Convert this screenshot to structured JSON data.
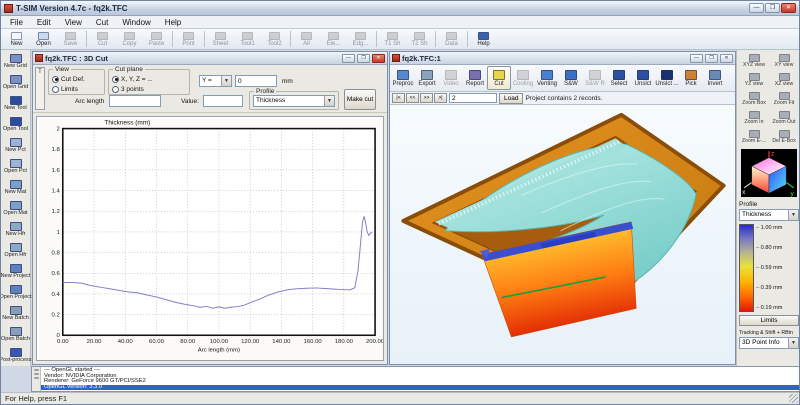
{
  "window": {
    "title": "T-SIM Version 4.7c - fq2k.TFC",
    "controls": {
      "minimize": "—",
      "maximize": "❐",
      "close": "✕"
    }
  },
  "menu": [
    "File",
    "Edit",
    "View",
    "Cut",
    "Window",
    "Help"
  ],
  "toolbar": {
    "groups": [
      {
        "items": [
          {
            "label": "New",
            "icon": "new-file",
            "enabled": true,
            "color": "#f2f7ff"
          },
          {
            "label": "Open",
            "icon": "open-folder",
            "enabled": true,
            "color": "#c9daf2"
          },
          {
            "label": "Save",
            "icon": "save",
            "enabled": false,
            "color": "#9aa2ac"
          }
        ]
      },
      {
        "items": [
          {
            "label": "Cut",
            "icon": "cut-scissors",
            "enabled": false,
            "color": "#9aa2ac"
          },
          {
            "label": "Copy",
            "icon": "copy",
            "enabled": false,
            "color": "#9aa2ac"
          },
          {
            "label": "Paste",
            "icon": "paste",
            "enabled": false,
            "color": "#9aa2ac"
          }
        ]
      },
      {
        "items": [
          {
            "label": "Print",
            "icon": "print",
            "enabled": false,
            "color": "#9aa2ac"
          }
        ]
      },
      {
        "items": [
          {
            "label": "Sheet",
            "icon": "sheet",
            "enabled": false,
            "color": "#9aa2ac"
          },
          {
            "label": "Tool1",
            "icon": "tool1",
            "enabled": false,
            "color": "#9aa2ac"
          },
          {
            "label": "Tool2",
            "icon": "tool2",
            "enabled": false,
            "color": "#9aa2ac"
          }
        ]
      },
      {
        "items": [
          {
            "label": "All",
            "icon": "show-all",
            "enabled": false,
            "color": "#9aa2ac"
          },
          {
            "label": "Ele...",
            "icon": "elements",
            "enabled": false,
            "color": "#9aa2ac"
          },
          {
            "label": "Edg...",
            "icon": "edges",
            "enabled": false,
            "color": "#9aa2ac"
          }
        ]
      },
      {
        "items": [
          {
            "label": "T1 Sh",
            "icon": "tool1-sheet",
            "enabled": false,
            "color": "#9aa2ac"
          },
          {
            "label": "T2 Sh",
            "icon": "tool2-sheet",
            "enabled": false,
            "color": "#9aa2ac"
          }
        ]
      },
      {
        "items": [
          {
            "label": "Data",
            "icon": "data",
            "enabled": false,
            "color": "#9aa2ac"
          }
        ]
      },
      {
        "items": [
          {
            "label": "Help",
            "icon": "help",
            "enabled": true,
            "color": "#3a5fae"
          }
        ]
      }
    ]
  },
  "left_rail": [
    {
      "label": "New Grid",
      "icon": "new-grid-icon",
      "color": "#7d8fc4"
    },
    {
      "label": "Open Grid",
      "icon": "open-grid-icon",
      "color": "#7d8fc4"
    },
    {
      "label": "New Tool",
      "icon": "new-tool-icon",
      "color": "#2d4a9e"
    },
    {
      "label": "Open Tool",
      "icon": "open-tool-icon",
      "color": "#2d4a9e"
    },
    {
      "label": "New Pct",
      "icon": "new-pct-icon",
      "color": "#9fb2d4"
    },
    {
      "label": "Open Pct",
      "icon": "open-pct-icon",
      "color": "#9fb2d4"
    },
    {
      "label": "New Mat",
      "icon": "new-mat-icon",
      "color": "#7ba0c8"
    },
    {
      "label": "Open Mat",
      "icon": "open-mat-icon",
      "color": "#7ba0c8"
    },
    {
      "label": "New Hfr",
      "icon": "new-hfr-icon",
      "color": "#8fa8c8"
    },
    {
      "label": "Open Hfr",
      "icon": "open-hfr-icon",
      "color": "#8fa8c8"
    },
    {
      "label": "New Project",
      "icon": "new-project-icon",
      "color": "#5f7fc0"
    },
    {
      "label": "Open Project",
      "icon": "open-project-icon",
      "color": "#5f7fc0"
    },
    {
      "label": "New Batch",
      "icon": "new-batch-icon",
      "color": "#8c9cb8"
    },
    {
      "label": "Open Batch",
      "icon": "open-batch-icon",
      "color": "#8c9cb8"
    },
    {
      "label": "Post-process",
      "icon": "post-process-icon",
      "color": "#3b55b0"
    }
  ],
  "cut_window": {
    "title": "fq2k.TFC : 3D Cut",
    "side_tab": "T",
    "view_group": {
      "label": "View",
      "options": [
        {
          "label": "Cut Def.",
          "selected": true
        },
        {
          "label": "Limits",
          "selected": false
        }
      ]
    },
    "cut_plane_group": {
      "label": "Cut plane",
      "options": [
        {
          "label": "X, Y, Z = ...",
          "selected": true
        },
        {
          "label": "3 points",
          "selected": false
        }
      ]
    },
    "axis_select": "Y =",
    "axis_value": "0",
    "axis_unit": "mm",
    "arc_length_label": "Arc length",
    "value_label": "Value:",
    "profile_group": {
      "label": "Profile",
      "selected": "Thickness"
    },
    "make_cut_label": "Make cut"
  },
  "chart_data": {
    "type": "line",
    "title": "Thickness (mm)",
    "xlabel": "Arc length (mm)",
    "ylabel": "",
    "xlim": [
      0,
      200
    ],
    "ylim": [
      0,
      2
    ],
    "grid": true,
    "x_ticks": [
      "0.00",
      "20.00",
      "40.00",
      "60.00",
      "80.00",
      "100.00",
      "120.00",
      "140.00",
      "160.00",
      "180.00",
      "200.00"
    ],
    "y_ticks": [
      "0",
      "0.2",
      "0.4",
      "0.6",
      "0.8",
      "1",
      "1.2",
      "1.4",
      "1.6",
      "1.8",
      "2"
    ],
    "series": [
      {
        "name": "Thickness",
        "color": "#8080c8",
        "points": [
          [
            0,
            0.51
          ],
          [
            6,
            0.51
          ],
          [
            12,
            0.505
          ],
          [
            18,
            0.48
          ],
          [
            24,
            0.465
          ],
          [
            30,
            0.45
          ],
          [
            36,
            0.435
          ],
          [
            42,
            0.42
          ],
          [
            48,
            0.41
          ],
          [
            54,
            0.39
          ],
          [
            60,
            0.37
          ],
          [
            66,
            0.345
          ],
          [
            72,
            0.32
          ],
          [
            78,
            0.3
          ],
          [
            84,
            0.285
          ],
          [
            88,
            0.27
          ],
          [
            92,
            0.28
          ],
          [
            96,
            0.262
          ],
          [
            100,
            0.275
          ],
          [
            104,
            0.262
          ],
          [
            108,
            0.272
          ],
          [
            112,
            0.278
          ],
          [
            116,
            0.29
          ],
          [
            120,
            0.315
          ],
          [
            126,
            0.35
          ],
          [
            132,
            0.39
          ],
          [
            138,
            0.42
          ],
          [
            144,
            0.44
          ],
          [
            150,
            0.45
          ],
          [
            156,
            0.455
          ],
          [
            162,
            0.458
          ],
          [
            168,
            0.452
          ],
          [
            174,
            0.447
          ],
          [
            180,
            0.441
          ],
          [
            184,
            0.44
          ],
          [
            187,
            0.46
          ],
          [
            189,
            0.62
          ],
          [
            190.5,
            0.85
          ],
          [
            192,
            1.1
          ],
          [
            193,
            1.15
          ],
          [
            194,
            1.08
          ],
          [
            195,
            1.0
          ],
          [
            196,
            0.965
          ],
          [
            197,
            0.985
          ],
          [
            198,
            1.0
          ]
        ]
      }
    ]
  },
  "view_window": {
    "title": "fq2k.TFC:1",
    "toolbar": [
      {
        "label": "Preproc",
        "icon": "preproc-icon",
        "enabled": true,
        "active": false,
        "color": "#5588cc"
      },
      {
        "label": "Export",
        "icon": "export-icon",
        "enabled": true,
        "active": false,
        "color": "#8aa2bc"
      },
      {
        "label": "Video",
        "icon": "video-icon",
        "enabled": false,
        "active": false,
        "color": "#9aa2ac"
      },
      {
        "label": "Report",
        "icon": "report-icon",
        "enabled": true,
        "active": false,
        "color": "#7a6fb0"
      },
      {
        "label": "Cut",
        "icon": "cut-plane-icon",
        "enabled": true,
        "active": true,
        "color": "#e8d44a"
      },
      {
        "label": "Cooling",
        "icon": "cooling-icon",
        "enabled": false,
        "active": false,
        "color": "#9aa2ac"
      },
      {
        "label": "Venting",
        "icon": "venting-icon",
        "enabled": true,
        "active": false,
        "color": "#4a7fd4"
      },
      {
        "label": "S&W",
        "icon": "sw-icon",
        "enabled": true,
        "active": false,
        "color": "#3a6fc4"
      },
      {
        "label": "S&W R",
        "icon": "sw-r-icon",
        "enabled": false,
        "active": false,
        "color": "#9aa2ac"
      },
      {
        "label": "Select",
        "icon": "select-icon",
        "enabled": true,
        "active": false,
        "color": "#2a4f9e"
      },
      {
        "label": "Unslct",
        "icon": "unselect-icon",
        "enabled": true,
        "active": false,
        "color": "#2a4f9e"
      },
      {
        "label": "Unslct ...",
        "icon": "unselect-all-icon",
        "enabled": true,
        "active": false,
        "color": "#1a2f6e"
      },
      {
        "label": "Pick",
        "icon": "pick-icon",
        "enabled": true,
        "active": false,
        "color": "#d08030"
      },
      {
        "label": "Invert",
        "icon": "invert-icon",
        "enabled": true,
        "active": false,
        "color": "#6888b8"
      }
    ],
    "record_bar": {
      "buttons": [
        "|<",
        "<<",
        ">>",
        ">|"
      ],
      "record_value": "2",
      "load_label": "Load",
      "status": "Project contains 2 records."
    }
  },
  "right_rail": {
    "view_buttons": [
      "XYZ view",
      "XY view",
      "YZ view",
      "XZ view",
      "Zoom Box",
      "Zoom Fit",
      "Zoom In",
      "Zoom Out",
      "Zoom E-...",
      "Del E-Box"
    ],
    "cube_axes": {
      "x": "x",
      "y": "y",
      "z": "z"
    },
    "profile_label": "Profile",
    "profile_value": "Thickness",
    "scale_labels": [
      "1.00 mm",
      "0.80 mm",
      "0.59 mm",
      "0.39 mm",
      "0.19 mm"
    ],
    "scale_colors": [
      "#2a2ad0",
      "#b6b494",
      "#e8e23a",
      "#ff9000",
      "#e81800"
    ],
    "limits_label": "Limits",
    "tracking_label": "Tracking &  Shift + RBtn",
    "tracking_value": "3D Point Info"
  },
  "log": {
    "lines": [
      {
        "text": "--- OpenGL started ---",
        "selected": false
      },
      {
        "text": "Vendor: NVIDIA Corporation",
        "selected": false
      },
      {
        "text": "Renderer: GeForce 9600 GT/PCI/SSE2",
        "selected": false
      },
      {
        "text": "OpenGL version: 3.3.0",
        "selected": true
      }
    ]
  },
  "statusbar": "For Help, press F1"
}
